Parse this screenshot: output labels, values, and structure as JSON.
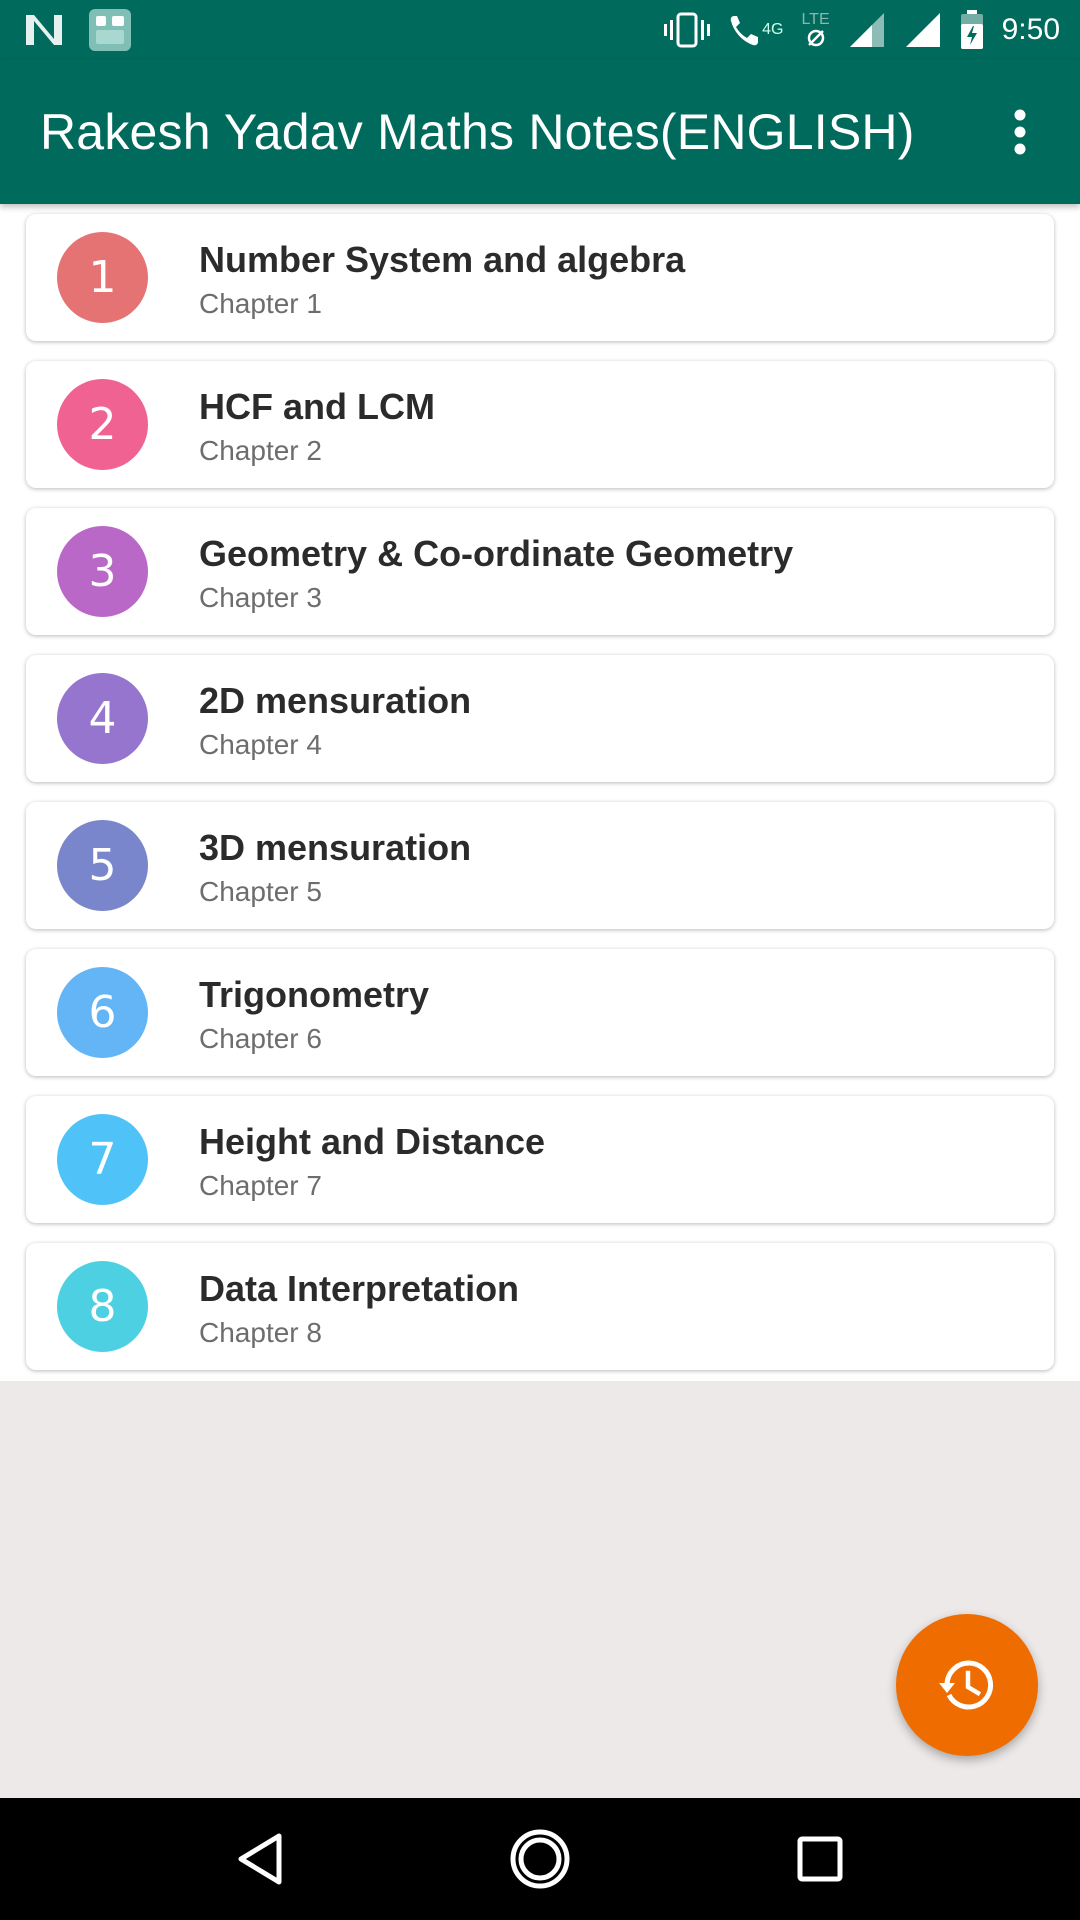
{
  "status_bar": {
    "time": "9:50",
    "network_label": "4G",
    "lte_label": "LTE",
    "icons": [
      "n-icon",
      "app-notification-icon",
      "vibrate-icon",
      "wifi-calling-icon",
      "data-off-icon",
      "signal-icon",
      "signal-icon",
      "battery-icon"
    ]
  },
  "app_bar": {
    "title": "Rakesh Yadav Maths Notes(ENGLISH)",
    "overflow_icon": "more-vert-icon",
    "color": "#006a5c"
  },
  "chapters": [
    {
      "number": "1",
      "title": "Number System and algebra",
      "subtitle": "Chapter 1",
      "color": "#e57373"
    },
    {
      "number": "2",
      "title": "HCF and LCM",
      "subtitle": "Chapter 2",
      "color": "#f06292"
    },
    {
      "number": "3",
      "title": "Geometry & Co-ordinate Geometry",
      "subtitle": "Chapter 3",
      "color": "#ba68c8"
    },
    {
      "number": "4",
      "title": "2D mensuration",
      "subtitle": "Chapter 4",
      "color": "#9575cd"
    },
    {
      "number": "5",
      "title": "3D mensuration",
      "subtitle": "Chapter 5",
      "color": "#7986cb"
    },
    {
      "number": "6",
      "title": "Trigonometry",
      "subtitle": "Chapter 6",
      "color": "#64b5f6"
    },
    {
      "number": "7",
      "title": "Height and Distance",
      "subtitle": "Chapter 7",
      "color": "#4fc3f7"
    },
    {
      "number": "8",
      "title": "Data Interpretation",
      "subtitle": "Chapter 8",
      "color": "#4dd0e1"
    }
  ],
  "fab": {
    "icon": "history-icon",
    "color": "#ef6c00"
  },
  "nav_bar": {
    "icons": [
      "back-icon",
      "home-icon",
      "recents-icon"
    ]
  }
}
